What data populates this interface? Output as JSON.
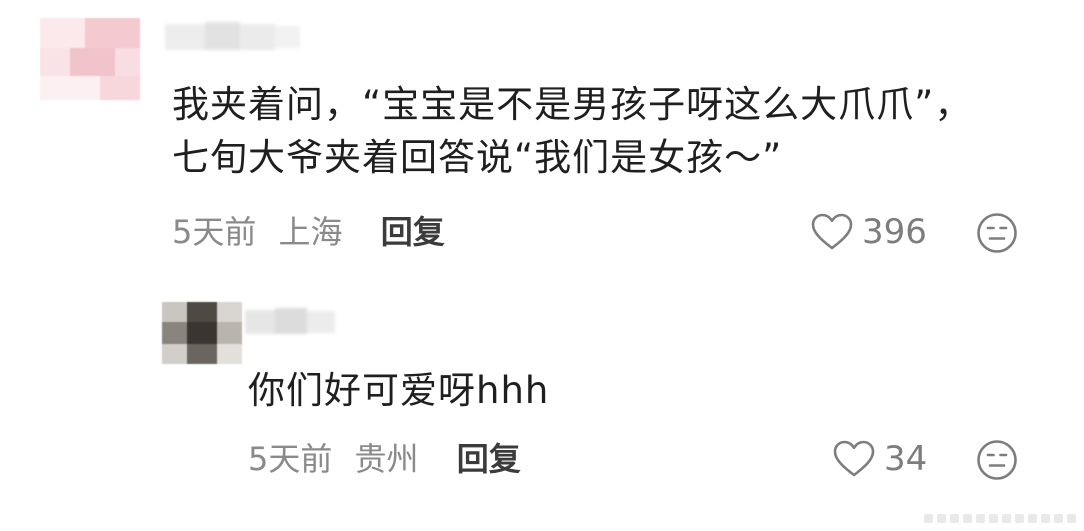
{
  "comments": [
    {
      "text": "我夹着问，“宝宝是不是男孩子呀这么大爪爪”，七旬大爷夹着回答说“我们是女孩～”",
      "time": "5天前",
      "location": "上海",
      "reply_label": "回复",
      "likes": "396",
      "like_icon": "heart-outline-icon",
      "dislike_icon": "meh-face-icon"
    },
    {
      "text": "你们好可爱呀hhh",
      "time": "5天前",
      "location": "贵州",
      "reply_label": "回复",
      "likes": "34",
      "like_icon": "heart-outline-icon",
      "dislike_icon": "meh-face-icon"
    }
  ],
  "colors": {
    "text": "#1f1f1f",
    "meta": "#8a8a8a",
    "icon": "#7d7d7d",
    "avatar1": "#f3c9cf",
    "avatar2": "#4a4540"
  }
}
